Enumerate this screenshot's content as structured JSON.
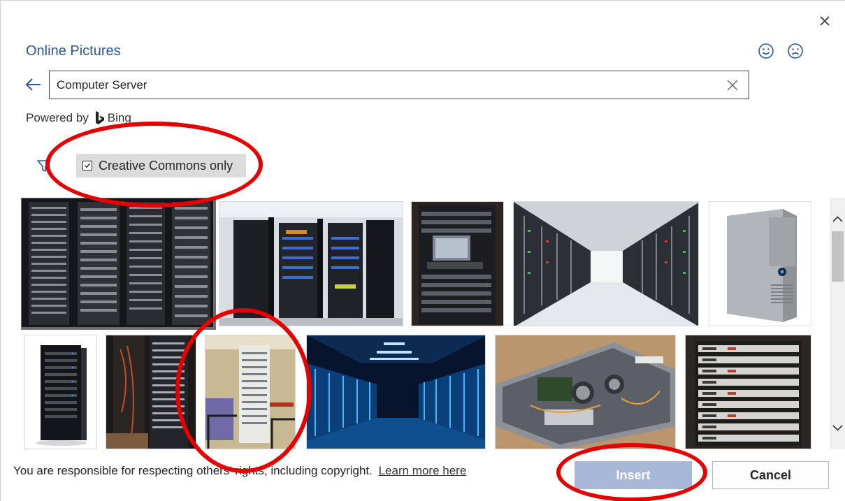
{
  "dialog": {
    "title": "Online Pictures",
    "close_icon": "close-icon",
    "feedback": {
      "smile_icon": "smile-icon",
      "frown_icon": "frown-icon"
    }
  },
  "search": {
    "value": "Computer Server",
    "back_icon": "back-arrow-icon",
    "clear_icon": "clear-icon"
  },
  "powered_by": {
    "prefix": "Powered by",
    "brand": "Bing"
  },
  "filter": {
    "filter_icon": "filter-icon",
    "creative_commons_label": "Creative Commons only",
    "creative_commons_checked": true
  },
  "results": [
    {
      "name": "server-racks-closeup",
      "selected": true
    },
    {
      "name": "open-server-cabinets"
    },
    {
      "name": "server-rack-with-monitor"
    },
    {
      "name": "data-center-aisle"
    },
    {
      "name": "tower-server"
    },
    {
      "name": "black-rack-cabinet"
    },
    {
      "name": "rack-cabling-dark"
    },
    {
      "name": "white-server-tower-lab"
    },
    {
      "name": "blue-lit-data-center"
    },
    {
      "name": "open-server-chassis"
    },
    {
      "name": "stacked-rack-servers"
    }
  ],
  "footer": {
    "notice": "You are responsible for respecting others' rights, including copyright.",
    "learn_more": "Learn more here",
    "insert_label": "Insert",
    "cancel_label": "Cancel"
  },
  "colors": {
    "accent": "#2b579a",
    "insert_disabled": "#a7b9d6",
    "annotation": "#e40000"
  }
}
